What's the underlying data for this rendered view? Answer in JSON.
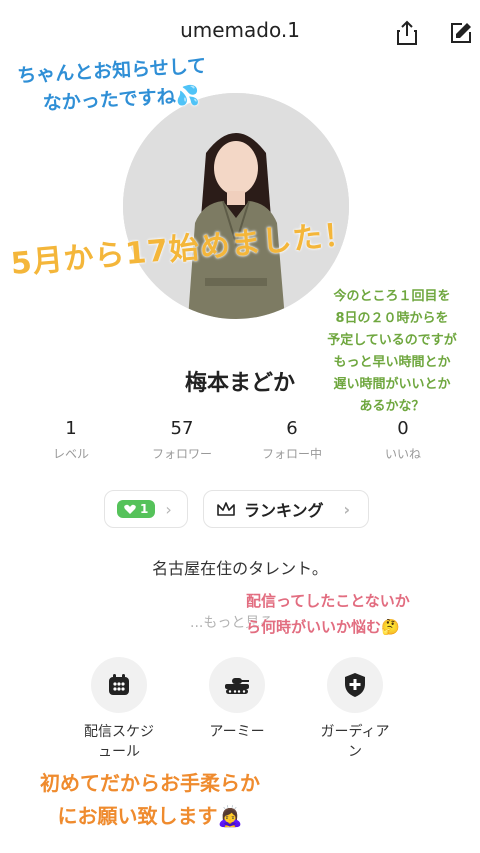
{
  "header": {
    "username": "umemado.1",
    "share_icon": "share-icon",
    "edit_icon": "edit-icon"
  },
  "profile": {
    "display_name": "梅本まどか",
    "stats": [
      {
        "value": "1",
        "label": "レベル"
      },
      {
        "value": "57",
        "label": "フォロワー"
      },
      {
        "value": "6",
        "label": "フォロー中"
      },
      {
        "value": "0",
        "label": "いいね"
      }
    ],
    "level_badge": "1",
    "ranking_label": "ランキング",
    "bio": "名古屋在住のタレント。",
    "more_link": "...もっと見る"
  },
  "menu": [
    {
      "label_line1": "配信スケジ",
      "label_line2": "ュール",
      "icon": "calendar-icon"
    },
    {
      "label_line1": "アーミー",
      "label_line2": "",
      "icon": "tank-icon"
    },
    {
      "label_line1": "ガーディア",
      "label_line2": "ン",
      "icon": "shield-icon"
    }
  ],
  "annotations": {
    "blue": [
      "ちゃんとお知らせして",
      "なかったですね💦"
    ],
    "yellow": "5月から17始めました！",
    "green": [
      "今のところ１回目を",
      "8日の２０時からを",
      "予定しているのですが",
      "もっと早い時間とか",
      "遅い時間がいいとか",
      "あるかな？"
    ],
    "pink": [
      "配信ってしたことないか",
      "ら何時がいいか悩む🤔"
    ],
    "orange": [
      "初めてだからお手柔らか",
      "にお願い致します🙇‍♀️"
    ]
  },
  "colors": {
    "accent_green": "#55c25a",
    "annotation_blue": "#2f8fd6",
    "annotation_yellow": "#f4b63a",
    "annotation_green": "#6fa73f",
    "annotation_pink": "#e26d80",
    "annotation_orange": "#ef8b2e"
  }
}
